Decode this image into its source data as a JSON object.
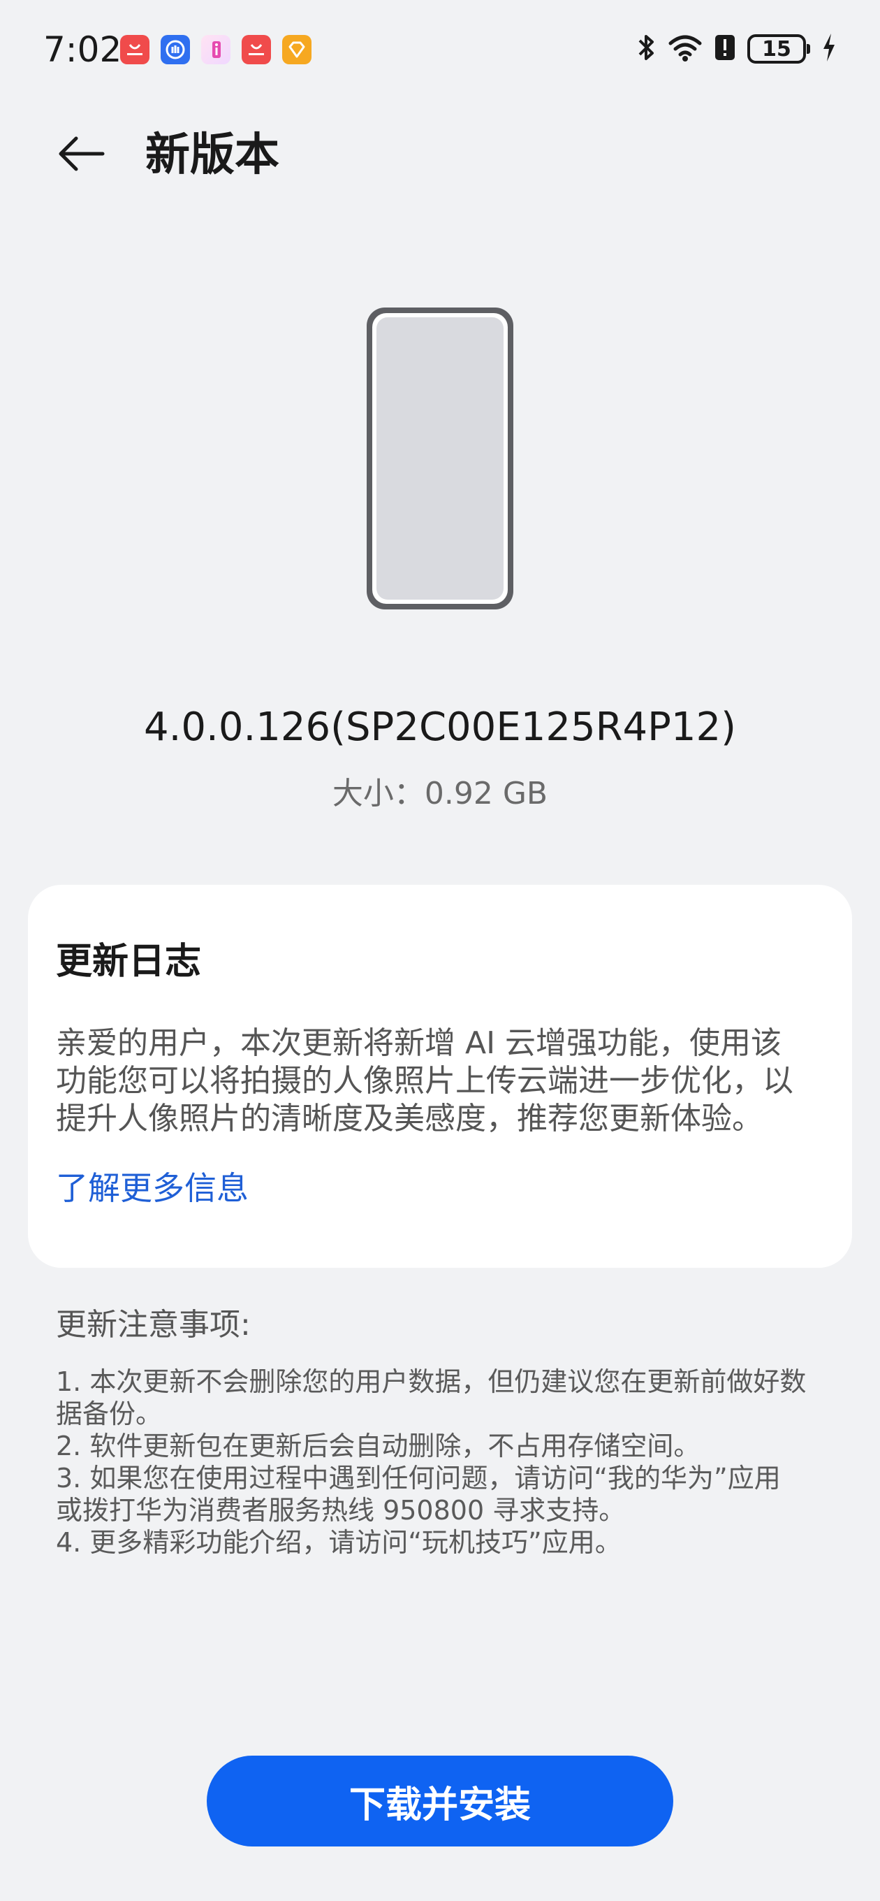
{
  "status_bar": {
    "time": "7:02",
    "battery_level": "15",
    "notification_icons": [
      "huawei-app-icon",
      "hand-app-icon",
      "info-app-icon",
      "huawei-app-icon",
      "diamond-app-icon"
    ],
    "system_icons": [
      "bluetooth-icon",
      "wifi-icon",
      "alert-icon",
      "battery-icon",
      "charging-icon"
    ]
  },
  "header": {
    "title": "新版本",
    "back_icon": "back-arrow-icon"
  },
  "update": {
    "version": "4.0.0.126(SP2C00E125R4P12)",
    "size_label": "大小：",
    "size_value": "0.92 GB"
  },
  "changelog": {
    "title": "更新日志",
    "body_lines": [
      "亲爱的用户，本次更新将新增 AI 云增强功能，使用该",
      "功能您可以将拍摄的人像照片上传云端进一步优化，以",
      "提升人像照片的清晰度及美感度，推荐您更新体验。"
    ],
    "learn_more": "了解更多信息"
  },
  "notes": {
    "title": "更新注意事项:",
    "lines": [
      "1. 本次更新不会删除您的用户数据，但仍建议您在更新前做好数",
      "据备份。",
      "2. 软件更新包在更新后会自动删除，不占用存储空间。",
      "3. 如果您在使用过程中遇到任何问题，请访问“我的华为”应用",
      "或拨打华为消费者服务热线 950800 寻求支持。",
      "4. 更多精彩功能介绍，请访问“玩机技巧”应用。"
    ]
  },
  "actions": {
    "install_label": "下载并安装"
  },
  "colors": {
    "background": "#f1f2f4",
    "accent": "#0f63f2",
    "link": "#1f5fd6"
  }
}
